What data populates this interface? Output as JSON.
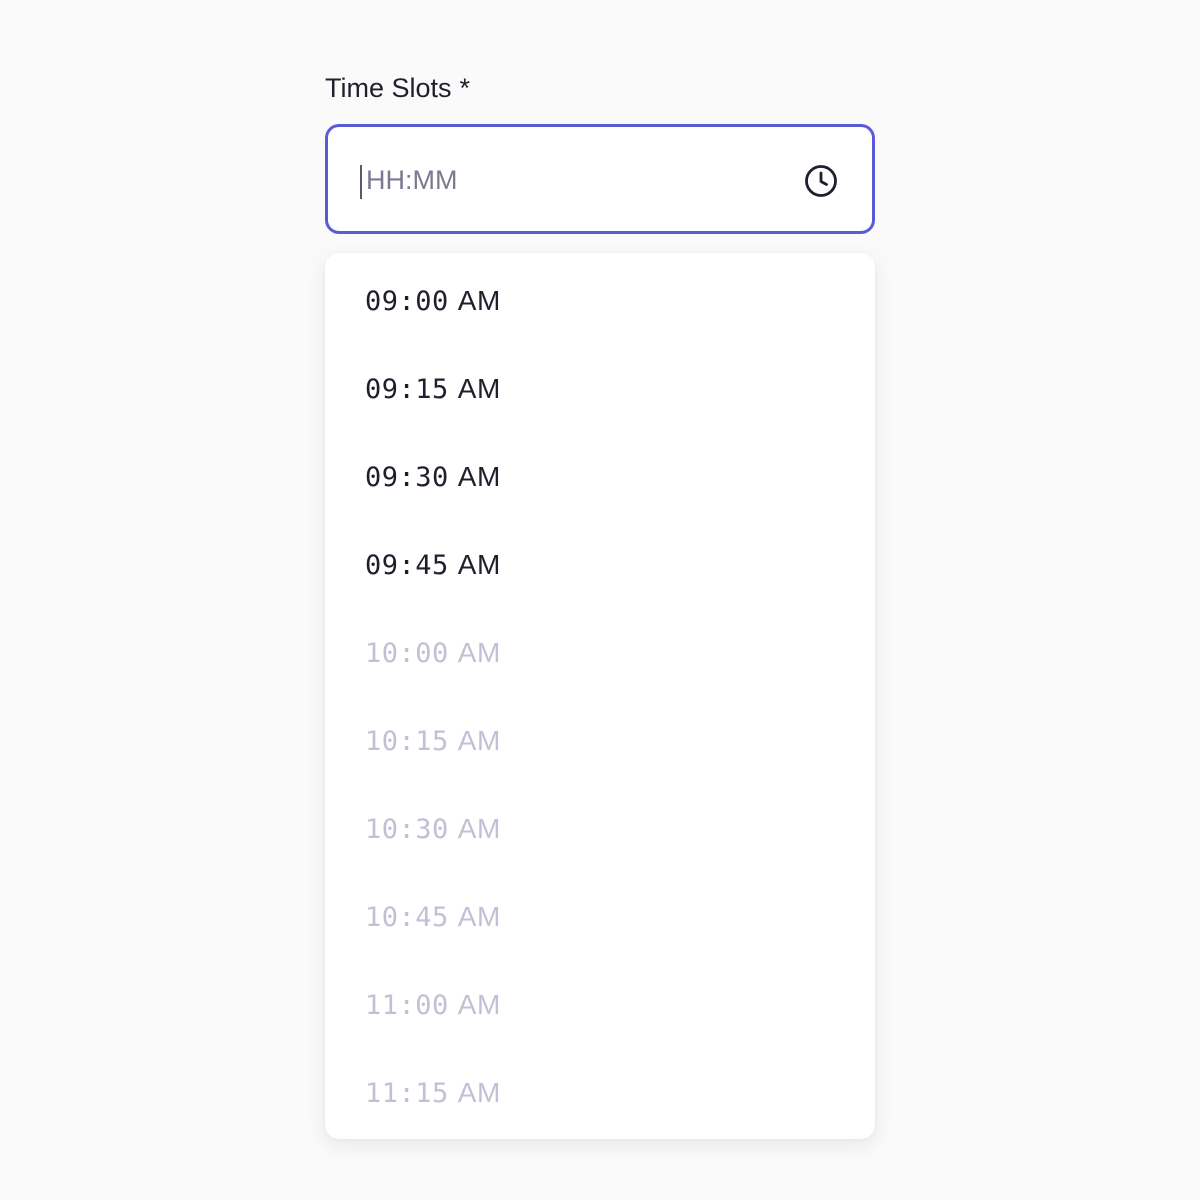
{
  "field": {
    "label": "Time Slots",
    "required_mark": "*",
    "input": {
      "value": "",
      "placeholder": "HH:MM"
    },
    "icon": "clock-icon"
  },
  "colors": {
    "accent": "#5b5bd6",
    "text": "#1f1f2e",
    "disabled_text": "#c2c0d6",
    "placeholder": "#7a7a90"
  },
  "options": [
    {
      "time": "09:00",
      "period": "AM",
      "disabled": false
    },
    {
      "time": "09:15",
      "period": "AM",
      "disabled": false
    },
    {
      "time": "09:30",
      "period": "AM",
      "disabled": false
    },
    {
      "time": "09:45",
      "period": "AM",
      "disabled": false
    },
    {
      "time": "10:00",
      "period": "AM",
      "disabled": true
    },
    {
      "time": "10:15",
      "period": "AM",
      "disabled": true
    },
    {
      "time": "10:30",
      "period": "AM",
      "disabled": true
    },
    {
      "time": "10:45",
      "period": "AM",
      "disabled": true
    },
    {
      "time": "11:00",
      "period": "AM",
      "disabled": true
    },
    {
      "time": "11:15",
      "period": "AM",
      "disabled": true
    }
  ]
}
